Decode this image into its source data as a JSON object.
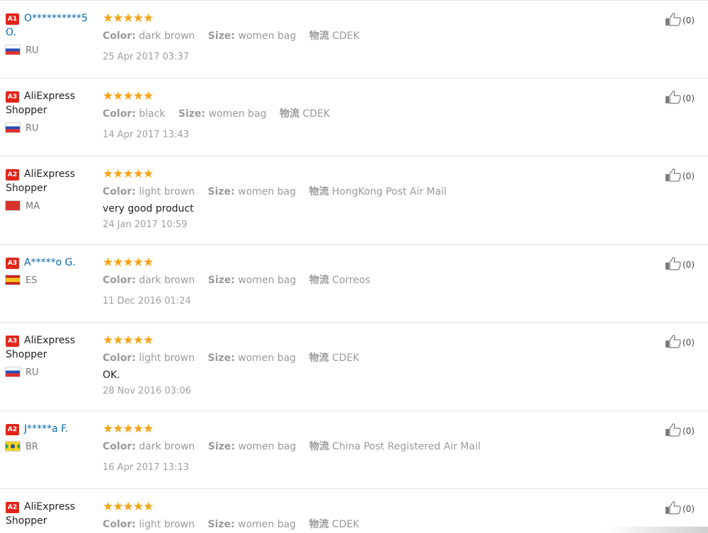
{
  "reviews": [
    {
      "level": "A1",
      "name_line1": "O**********5",
      "name_line2": "O.",
      "masked": true,
      "country": "RU",
      "flag": "ru",
      "stars": "★★★★★",
      "color_label": "Color:",
      "color": "dark brown",
      "size_label": "Size:",
      "size": "women bag",
      "logistics_label": "物流",
      "logistics": "CDEK",
      "feedback": "",
      "date": "25 Apr 2017 03:37",
      "helpful": "(0)"
    },
    {
      "level": "A3",
      "name_line1": "AliExpress",
      "name_line2": "Shopper",
      "masked": false,
      "country": "RU",
      "flag": "ru",
      "stars": "★★★★★",
      "color_label": "Color:",
      "color": "black",
      "size_label": "Size:",
      "size": "women bag",
      "logistics_label": "物流",
      "logistics": "CDEK",
      "feedback": "",
      "date": "14 Apr 2017 13:43",
      "helpful": "(0)"
    },
    {
      "level": "A2",
      "name_line1": "AliExpress",
      "name_line2": "Shopper",
      "masked": false,
      "country": "MA",
      "flag": "ma",
      "stars": "★★★★★",
      "color_label": "Color:",
      "color": "light brown",
      "size_label": "Size:",
      "size": "women bag",
      "logistics_label": "物流",
      "logistics": "HongKong Post Air Mail",
      "feedback": "very good product",
      "date": "24 Jan 2017 10:59",
      "helpful": "(0)"
    },
    {
      "level": "A3",
      "name_line1": "A*****o G.",
      "name_line2": "",
      "masked": true,
      "country": "ES",
      "flag": "es",
      "stars": "★★★★★",
      "color_label": "Color:",
      "color": "dark brown",
      "size_label": "Size:",
      "size": "women bag",
      "logistics_label": "物流",
      "logistics": "Correos",
      "feedback": "",
      "date": "11 Dec 2016 01:24",
      "helpful": "(0)"
    },
    {
      "level": "A3",
      "name_line1": "AliExpress",
      "name_line2": "Shopper",
      "masked": false,
      "country": "RU",
      "flag": "ru",
      "stars": "★★★★★",
      "color_label": "Color:",
      "color": "light brown",
      "size_label": "Size:",
      "size": "women bag",
      "logistics_label": "物流",
      "logistics": "CDEK",
      "feedback": "OK.",
      "date": "28 Nov 2016 03:06",
      "helpful": "(0)"
    },
    {
      "level": "A2",
      "name_line1": "J*****a F.",
      "name_line2": "",
      "masked": true,
      "country": "BR",
      "flag": "br",
      "stars": "★★★★★",
      "color_label": "Color:",
      "color": "dark brown",
      "size_label": "Size:",
      "size": "women bag",
      "logistics_label": "物流",
      "logistics": "China Post Registered Air Mail",
      "feedback": "",
      "date": "16 Apr 2017 13:13",
      "helpful": "(0)"
    },
    {
      "level": "A2",
      "name_line1": "AliExpress",
      "name_line2": "Shopper",
      "masked": false,
      "country": "",
      "flag": "",
      "stars": "★★★★★",
      "color_label": "Color:",
      "color": "light brown",
      "size_label": "Size:",
      "size": "women bag",
      "logistics_label": "物流",
      "logistics": "CDEK",
      "feedback": "",
      "date": "",
      "helpful": "(0)"
    }
  ]
}
